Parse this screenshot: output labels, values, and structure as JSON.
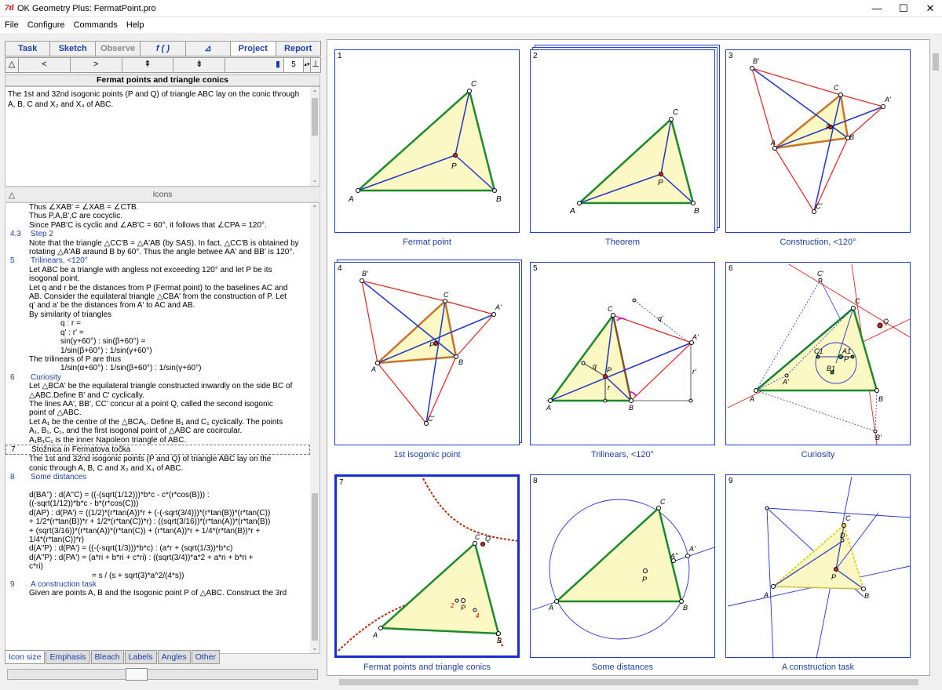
{
  "window": {
    "icon": "7tl",
    "title": "OK Geometry Plus:  FermatPoint.pro",
    "min": "—",
    "max": "☐",
    "close": "✕"
  },
  "menu": [
    "File",
    "Configure",
    "Commands",
    "Help"
  ],
  "tabs": [
    {
      "label": "Task",
      "state": "normal"
    },
    {
      "label": "Sketch",
      "state": "normal"
    },
    {
      "label": "Observe",
      "state": "disabled"
    },
    {
      "label": "f ( )",
      "state": "normal"
    },
    {
      "label": "⊿",
      "state": "normal"
    },
    {
      "label": "Project",
      "state": "active"
    },
    {
      "label": "Report",
      "state": "normal"
    }
  ],
  "nav": {
    "up": "△",
    "prev": "<",
    "next": ">",
    "first": "⇞",
    "last": "⇟",
    "marker": "▮",
    "value": "5",
    "spin": "▴▾",
    "end": "⊥"
  },
  "project_title": "Fermat points and triangle conics",
  "description": "The 1st and 32nd isogonic points (P and Q) of triangle ABC lay on the conic through A, B, C and X₂ and X₄ of ABC.",
  "icons_header": {
    "toggle": "△",
    "label": "Icons"
  },
  "steps": [
    {
      "k": "t",
      "text": "Thus ∠XAB' = ∠XAB = ∠CTB."
    },
    {
      "k": "t",
      "text": "Thus P,A,B',C are cocyclic."
    },
    {
      "k": "t",
      "text": "Since PAB'C is cyclic and ∠AB'C = 60°, it follows that  ∠CPA = 120°."
    },
    {
      "k": "h",
      "n": "4.3",
      "text": "Step 2"
    },
    {
      "k": "t",
      "text": "Note that the triangle △CC'B = △A'AB (by SAS). In fact, △CC'B is obtained by"
    },
    {
      "k": "t",
      "text": "rotating △A'AB araund B by 60°. Thus the angle betwee AA' and BB' is 120°."
    },
    {
      "k": "h",
      "n": "5",
      "text": "Trilinears, <120°"
    },
    {
      "k": "t",
      "text": "Let ABC be a triangle with angless not exceeding 120° and let P be its"
    },
    {
      "k": "t",
      "text": "isogonal point."
    },
    {
      "k": "t",
      "text": "Let q and r be the distances from P (Fermat point) to the baselines AC and"
    },
    {
      "k": "t",
      "text": "AB. Consider the equilateral triangle △CBA' from the construction of P. Let"
    },
    {
      "k": "t",
      "text": "q' and a' be the distances from A' to AC and AB."
    },
    {
      "k": "t",
      "text": "By similarity of triangles"
    },
    {
      "k": "i",
      "text": "q : r ="
    },
    {
      "k": "i",
      "text": "q' : r' ="
    },
    {
      "k": "i",
      "text": "sin(γ+60°) : sin(β+60°) ="
    },
    {
      "k": "i",
      "text": "1/sin(β+60°) : 1/sin(γ+60°)"
    },
    {
      "k": "t",
      "text": "The trilinears of P are thus"
    },
    {
      "k": "i",
      "text": "1/sin(α+60°) :  1/sin(β+60°) : 1/sin(γ+60°)"
    },
    {
      "k": "h",
      "n": "6",
      "text": "Curiosity"
    },
    {
      "k": "t",
      "text": "Let △BCA' be the equilateral triangle constructed inwardly on the side BC of"
    },
    {
      "k": "t",
      "text": "△ABC.Define B' and C' cyclically."
    },
    {
      "k": "t",
      "text": "The lines AA', BB', CC' concur at a point Q, called the second isogonic"
    },
    {
      "k": "t",
      "text": "point of △ABC."
    },
    {
      "k": "t",
      "text": "Let A₁ be the centre of the △BCA₁. Define B₁ and C₁ cyclically. The points"
    },
    {
      "k": "t",
      "text": "A₁, B₁, C₁, and the first isogonal point of △ABC are cocircular."
    },
    {
      "k": "t",
      "text": "A₁B₁C₁ is the inner Napoleon triangle of ABC."
    },
    {
      "k": "s",
      "n": "7",
      "text": "Stožnica in Fermatova točka"
    },
    {
      "k": "t",
      "text": "The 1st and 32nd isogonic points (P and Q) of triangle ABC lay on the"
    },
    {
      "k": "t",
      "text": "conic through A, B, C and X₂ and X₄ of ABC."
    },
    {
      "k": "h",
      "n": "8",
      "text": "Some distances"
    },
    {
      "k": "b",
      "text": ""
    },
    {
      "k": "t",
      "text": "d(BA'') : d(A''C) = ((-(sqrt(1/12)))*b*c - c*(r*cos(B))) :"
    },
    {
      "k": "t",
      "text": "((-sqrt(1/12))*b*c - b*(r*cos(C)))"
    },
    {
      "k": "t",
      "text": "d(AP) : d(PA') = ((1/2)*(r*tan(A))*r + (-(-sqrt(3/4)))*(r*tan(B))*(r*tan(C))"
    },
    {
      "k": "t",
      "text": "+ 1/2*(r*tan(B))*r + 1/2*(r*tan(C))*r) : ((sqrt(3/16))*(r*tan(A))*(r*tan(B))"
    },
    {
      "k": "t",
      "text": "+ (sqrt(3/16))*(r*tan(A))*(r*tan(C)) + (r*tan(A))*r + 1/4*(r*tan(B))*r +"
    },
    {
      "k": "t",
      "text": "1/4*(r*tan(C))*r)"
    },
    {
      "k": "t",
      "text": "d(A''P) : d(PA') = ((-(-sqrt(1/3)))*b*c) : (a*r + (sqrt(1/3))*b*c)"
    },
    {
      "k": "t",
      "text": "d(A''P) : d(PA') = (a*ri + b*ri + c*ri) : ((sqrt(3/4))*a*2 + a*ri + b*ri +"
    },
    {
      "k": "t",
      "text": "c*ri)"
    },
    {
      "k": "i2",
      "text": "= s / (s + sqrt(3)*a^2/(4*s))"
    },
    {
      "k": "h",
      "n": "9",
      "text": "A construction task"
    },
    {
      "k": "t",
      "text": "Given are points A, B and the Isogonic point P of △ABC. Construct the 3rd"
    }
  ],
  "bottom_tabs": [
    {
      "label": "Icon size",
      "state": "active"
    },
    {
      "label": "Emphasis",
      "state": "normal"
    },
    {
      "label": "Bleach",
      "state": "normal"
    },
    {
      "label": "Labels",
      "state": "normal"
    },
    {
      "label": "Angles",
      "state": "normal"
    },
    {
      "label": "Other",
      "state": "normal"
    }
  ],
  "cards": [
    {
      "num": "1",
      "caption": "Fermat point"
    },
    {
      "num": "2",
      "caption": "Theorem"
    },
    {
      "num": "3",
      "caption": "Construction, <120°"
    },
    {
      "num": "4",
      "caption": "1st isogonic point"
    },
    {
      "num": "5",
      "caption": "Trilinears, <120°"
    },
    {
      "num": "6",
      "caption": "Curiosity"
    },
    {
      "num": "7",
      "caption": "Fermat points and triangle conics"
    },
    {
      "num": "8",
      "caption": "Some distances"
    },
    {
      "num": "9",
      "caption": "A construction task"
    }
  ],
  "labels": {
    "A": "A",
    "B": "B",
    "C": "C",
    "P": "P",
    "Q": "Q",
    "A1": "A'",
    "B1": "B'",
    "C1": "C'",
    "A2": "A''",
    "Cc1": "C1",
    "Aa1": "A1",
    "Bb1": "B1",
    "D": "D",
    "q": "q",
    "r": "r",
    "q1": "q'",
    "r1": "r'",
    "n2": "2",
    "n4": "4"
  },
  "colors": {
    "accent": "#1f3fa6",
    "frame": "#2440c8",
    "green": "#1a8a2a",
    "red": "#e02020",
    "blue": "#2233cc",
    "fill": "#fbf8c4",
    "orange": "#c8742e",
    "conic": "#b03010"
  }
}
